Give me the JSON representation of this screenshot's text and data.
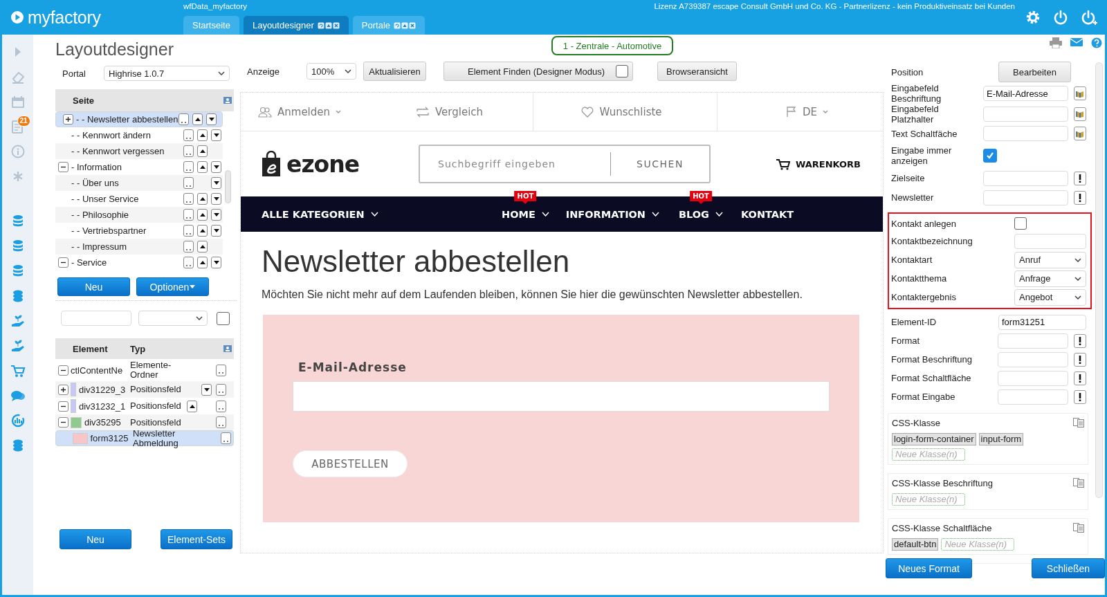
{
  "topbar": {
    "brand": "myfactory",
    "database": "wfData_myfactory",
    "license": "Lizenz A739387 escape Consult GmbH und Co. KG - Partnerlizenz - kein Produktiveinsatz bei Kunden",
    "tabs": [
      {
        "label": "Startseite",
        "selected": false,
        "closable": false
      },
      {
        "label": "Layoutdesigner",
        "selected": true,
        "closable": true
      },
      {
        "label": "Portale",
        "selected": false,
        "closable": true
      }
    ]
  },
  "rail": {
    "badge": "21"
  },
  "designer": {
    "title": "Layoutdesigner",
    "context": "1 - Zentrale - Automotive",
    "portal_label": "Portal",
    "portal": "Highrise 1.0.7",
    "zoom_label": "Anzeige",
    "zoom": "100%",
    "refresh_button": "Aktualisieren",
    "find_button": {
      "label": "Element Finden (Designer Modus)",
      "checked": false
    },
    "browser_button": "Browseransicht"
  },
  "pages": {
    "header": "Seite",
    "items": [
      {
        "label": "- - Newsletter abbestellen",
        "selected": true,
        "expanded": false,
        "can_up": true,
        "can_down": true
      },
      {
        "label": "- - Kennwort ändern",
        "selected": false,
        "can_up": true,
        "can_down": true
      },
      {
        "label": "- - Kennwort vergessen",
        "selected": false,
        "can_up": true,
        "can_down": false
      },
      {
        "label": "- Information",
        "selected": false,
        "expanded": true,
        "can_up": true,
        "can_down": true,
        "children": [
          {
            "label": "- - Über uns",
            "selected": false,
            "can_up": false,
            "can_down": true
          },
          {
            "label": "- - Unser Service",
            "selected": false,
            "can_up": true,
            "can_down": true
          },
          {
            "label": "- - Philosophie",
            "selected": false,
            "can_up": true,
            "can_down": true
          },
          {
            "label": "- - Vertriebspartner",
            "selected": false,
            "can_up": true,
            "can_down": true
          },
          {
            "label": "- - Impressum",
            "selected": false,
            "can_up": true,
            "can_down": false
          }
        ]
      },
      {
        "label": "- Service",
        "selected": false,
        "expanded": true,
        "can_up": true,
        "can_down": true
      }
    ],
    "buttons": [
      "Neu",
      "Optionen"
    ]
  },
  "elements": {
    "filter_checked": false,
    "columns": [
      "Element",
      "Typ"
    ],
    "rows": [
      {
        "name": "ctlContentNe",
        "type": "Elemente-Ordner",
        "expanded": true,
        "selected": false,
        "can_up": false,
        "can_down": false,
        "children": [
          {
            "name": "div31229_3",
            "type": "Positionsfeld",
            "expanded": false,
            "selected": false,
            "can_up": false,
            "can_down": true,
            "color": "#c8c8f6"
          },
          {
            "name": "div31232_1",
            "type": "Positionsfeld",
            "expanded": true,
            "selected": false,
            "can_up": true,
            "can_down": false,
            "color": "#c8c8f6",
            "children": [
              {
                "name": "div35295",
                "type": "Positionsfeld",
                "expanded": true,
                "selected": false,
                "can_up": false,
                "can_down": false,
                "color": "#8fcb8f",
                "children": [
                  {
                    "name": "form3125",
                    "type": "Newsletter Abmeldung",
                    "selected": true,
                    "can_up": false,
                    "can_down": false,
                    "color": "#f8c6c6"
                  }
                ]
              }
            ]
          }
        ]
      }
    ],
    "buttons": [
      "Neu",
      "Element-Sets"
    ]
  },
  "preview": {
    "top_links": [
      {
        "kind": "users",
        "label": "Anmelden",
        "dropdown": true
      },
      {
        "kind": "compare",
        "label": "Vergleich",
        "dropdown": false
      },
      {
        "kind": "heart",
        "label": "Wunschliste",
        "dropdown": false
      },
      {
        "kind": "flag",
        "label": "DE",
        "dropdown": true
      }
    ],
    "logo": "ezone",
    "search_placeholder": "Suchbegriff eingeben",
    "search_button": "SUCHEN",
    "cart": "WARENKORB",
    "nav": [
      {
        "label": "ALLE KATEGORIEN",
        "dropdown": true
      },
      {
        "label": "HOME",
        "dropdown": true,
        "badge": "HOT"
      },
      {
        "label": "INFORMATION",
        "dropdown": true
      },
      {
        "label": "BLOG",
        "dropdown": true,
        "badge": "HOT"
      },
      {
        "label": "KONTAKT",
        "dropdown": false
      }
    ],
    "heading": "Newsletter abbestellen",
    "intro": "Möchten Sie nicht mehr auf dem Laufenden bleiben, können Sie hier die gewünschten Newsletter abbestellen.",
    "form": {
      "label": "E-Mail-Adresse",
      "button": "ABBESTELLEN"
    }
  },
  "properties": {
    "general": [
      {
        "kind": "button",
        "label": "Position",
        "button": "Bearbeiten"
      },
      {
        "kind": "translatable",
        "label": "Eingabefeld Beschriftung",
        "value": "E-Mail-Adresse"
      },
      {
        "kind": "translatable",
        "label": "Eingabefeld Platzhalter"
      },
      {
        "kind": "translatable",
        "label": "Text Schaltfäche"
      },
      {
        "kind": "checkbox",
        "label": "Eingabe immer anzeigen",
        "checked": true
      },
      {
        "kind": "lookup",
        "label": "Zielseite"
      },
      {
        "kind": "lookup",
        "label": "Newsletter"
      }
    ],
    "contact": {
      "highlighted": true,
      "rows": [
        {
          "kind": "checkbox",
          "label": "Kontakt anlegen",
          "checked": false
        },
        {
          "kind": "text",
          "label": "Kontaktbezeichnung"
        },
        {
          "kind": "select",
          "label": "Kontaktart",
          "value": "Anruf"
        },
        {
          "kind": "select",
          "label": "Kontaktthema",
          "value": "Anfrage"
        },
        {
          "kind": "select",
          "label": "Kontaktergebnis",
          "value": "Angebot"
        }
      ]
    },
    "format": [
      {
        "kind": "text",
        "label": "Element-ID",
        "value": "form31251"
      },
      {
        "kind": "lookup",
        "label": "Format"
      },
      {
        "kind": "lookup",
        "label": "Format Beschriftung"
      },
      {
        "kind": "lookup",
        "label": "Format Schaltfläche"
      },
      {
        "kind": "lookup",
        "label": "Format Eingabe"
      }
    ],
    "class_groups": [
      {
        "label": "CSS-Klasse",
        "tags": [
          "login-form-container",
          "input-form"
        ],
        "placeholder": "Neue Klasse(n)"
      },
      {
        "label": "CSS-Klasse Beschriftung",
        "placeholder": "Neue Klasse(n)"
      },
      {
        "label": "CSS-Klasse Schaltfläche",
        "tags": [
          "default-btn"
        ],
        "placeholder": "Neue Klasse(n)"
      }
    ],
    "buttons": [
      "Neues Format",
      "Schließen"
    ]
  }
}
